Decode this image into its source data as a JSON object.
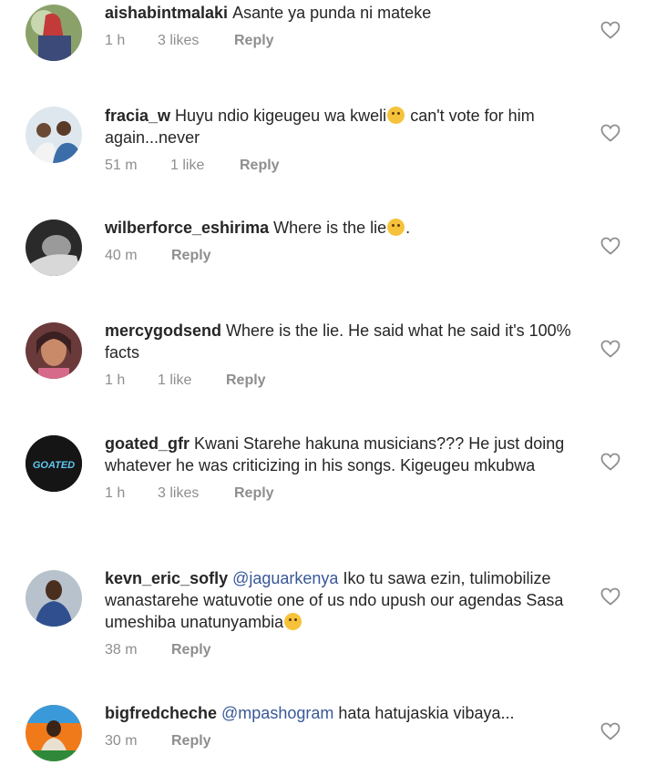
{
  "comments": [
    {
      "username": "aishabintmalaki",
      "mention": "",
      "text": "Asante ya punda ni mateke",
      "emoji": "",
      "trail": "",
      "time": "1 h",
      "likes": "3 likes",
      "reply": "Reply",
      "avatar": "photo-avatar"
    },
    {
      "username": "fracia_w",
      "mention": "",
      "text": "Huyu ndio kigeugeu wa kweli",
      "emoji": "hushed-face-emoji",
      "trail": " can't vote for him again...never",
      "time": "51 m",
      "likes": "1 like",
      "reply": "Reply",
      "avatar": "photo-avatar"
    },
    {
      "username": "wilberforce_eshirima",
      "mention": "",
      "text": "Where is the lie",
      "emoji": "crying-face-emoji",
      "trail": ".",
      "time": "40 m",
      "likes": "",
      "reply": "Reply",
      "avatar": "photo-avatar"
    },
    {
      "username": "mercygodsend",
      "mention": "",
      "text": "Where is the lie. He said what he said it's 100% facts",
      "emoji": "",
      "trail": "",
      "time": "1 h",
      "likes": "1 like",
      "reply": "Reply",
      "avatar": "photo-avatar"
    },
    {
      "username": "goated_gfr",
      "mention": "",
      "text": "Kwani Starehe hakuna musicians??? He just doing whatever he was criticizing in his songs. Kigeugeu mkubwa",
      "emoji": "",
      "trail": "",
      "time": "1 h",
      "likes": "3 likes",
      "reply": "Reply",
      "avatar": "goated-logo-avatar",
      "avatar_text": "GOATED"
    },
    {
      "username": "kevn_eric_sofly",
      "mention": "@jaguarkenya",
      "text": " Iko tu sawa ezin, tulimobilize wanastarehe watuvotie one of us ndo upush our agendas Sasa umeshiba unatunyambia",
      "emoji": "thinking-face-emoji",
      "trail": "",
      "time": "38 m",
      "likes": "",
      "reply": "Reply",
      "avatar": "photo-avatar"
    },
    {
      "username": "bigfredcheche",
      "mention": "@mpashogram",
      "text": " hata hatujaskia vibaya...",
      "emoji": "",
      "trail": "",
      "time": "30 m",
      "likes": "",
      "reply": "Reply",
      "avatar": "photo-avatar"
    }
  ],
  "icons": {
    "like": "heart-outline-icon"
  },
  "colors": {
    "text": "#262626",
    "meta": "#8e8e8e",
    "mention": "#385898"
  }
}
